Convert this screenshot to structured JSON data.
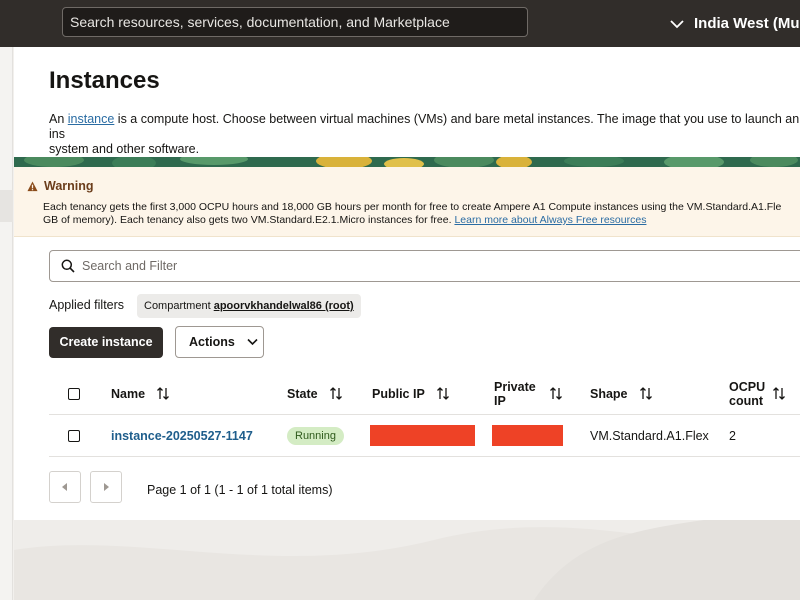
{
  "topbar": {
    "search_placeholder": "Search resources, services, documentation, and Marketplace",
    "region": "India West (Mum"
  },
  "page": {
    "title": "Instances",
    "desc_prefix": "An ",
    "desc_link": "instance",
    "desc_line1_rest": " is a compute host. Choose between virtual machines (VMs) and bare metal instances. The image that you use to launch an ins",
    "desc_line2": "system and other software."
  },
  "warning": {
    "title": "Warning",
    "line1": "Each tenancy gets the first 3,000 OCPU hours and 18,000 GB hours per month for free to create Ampere A1 Compute instances using the VM.Standard.A1.Fle",
    "line2": "GB of memory). Each tenancy also gets two VM.Standard.E2.1.Micro instances for free. ",
    "link": "Learn more about Always Free resources"
  },
  "filter": {
    "placeholder": "Search and Filter",
    "applied_label": "Applied filters",
    "chip_prefix": "Compartment ",
    "chip_value": "apoorvkhandelwal86 (root)"
  },
  "buttons": {
    "create": "Create instance",
    "actions": "Actions"
  },
  "table": {
    "headers": {
      "name": "Name",
      "state": "State",
      "public_ip": "Public IP",
      "private_ip_1": "Private",
      "private_ip_2": "IP",
      "shape": "Shape",
      "ocpu_1": "OCPU",
      "ocpu_2": "count"
    },
    "rows": [
      {
        "name": "instance-20250527-1147",
        "state": "Running",
        "shape": "VM.Standard.A1.Flex",
        "ocpu": "2"
      }
    ]
  },
  "pagination": {
    "text": "Page 1 of 1 (1 - 1 of 1 total items)"
  },
  "colors": {
    "topbar": "#312d2a",
    "link": "#2a6ca3",
    "running_badge": "#d4ecc4",
    "redaction": "#ee4226"
  }
}
